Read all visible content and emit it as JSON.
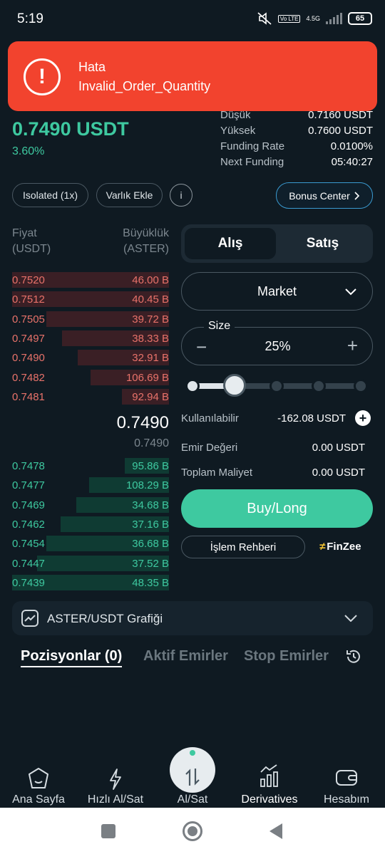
{
  "status_bar": {
    "time": "5:19",
    "lte_label": "Vo LTE",
    "network": "4.5G",
    "battery": "65"
  },
  "toast": {
    "title": "Hata",
    "message": "Invalid_Order_Quantity",
    "icon": "alert-icon",
    "color": "#f2432e"
  },
  "ticker": {
    "price": "0.7490 USDT",
    "change": "3.60%",
    "stats": [
      {
        "label": "Düşük",
        "value": "0.7160 USDT"
      },
      {
        "label": "Yüksek",
        "value": "0.7600 USDT"
      },
      {
        "label": "Funding Rate",
        "value": "0.0100%"
      },
      {
        "label": "Next Funding",
        "value": "05:40:27"
      }
    ]
  },
  "controls": {
    "isolated": "Isolated (1x)",
    "add_asset": "Varlık Ekle",
    "info": "i",
    "bonus": "Bonus Center"
  },
  "orderbook": {
    "header_price": "Fiyat",
    "header_price_unit": "(USDT)",
    "header_size": "Büyüklük",
    "header_size_unit": "(ASTER)",
    "asks": [
      {
        "price": "0.7520",
        "size": "46.00 B",
        "depth": 1.0
      },
      {
        "price": "0.7512",
        "size": "40.45 B",
        "depth": 1.0
      },
      {
        "price": "0.7505",
        "size": "39.72 B",
        "depth": 0.78
      },
      {
        "price": "0.7497",
        "size": "38.33 B",
        "depth": 0.68
      },
      {
        "price": "0.7490",
        "size": "32.91 B",
        "depth": 0.58
      },
      {
        "price": "0.7482",
        "size": "106.69 B",
        "depth": 0.5
      },
      {
        "price": "0.7481",
        "size": "92.94 B",
        "depth": 0.3
      }
    ],
    "mid_price": "0.7490",
    "mark_price": "0.7490",
    "bids": [
      {
        "price": "0.7478",
        "size": "95.86 B",
        "depth": 0.28
      },
      {
        "price": "0.7477",
        "size": "108.29 B",
        "depth": 0.51
      },
      {
        "price": "0.7469",
        "size": "34.68 B",
        "depth": 0.59
      },
      {
        "price": "0.7462",
        "size": "37.16 B",
        "depth": 0.69
      },
      {
        "price": "0.7454",
        "size": "36.68 B",
        "depth": 0.78
      },
      {
        "price": "0.7447",
        "size": "37.52 B",
        "depth": 0.84
      },
      {
        "price": "0.7439",
        "size": "48.35 B",
        "depth": 1.0
      }
    ]
  },
  "trade": {
    "buy_tab": "Alış",
    "sell_tab": "Satış",
    "order_type": "Market",
    "size_label": "Size",
    "size_value": "25%",
    "size_fraction": 0.25,
    "available_label": "Kullanılabilir",
    "available_value": "-162.08 USDT",
    "order_value_label": "Emir Değeri",
    "order_value": "0.00 USDT",
    "total_cost_label": "Toplam Maliyet",
    "total_cost": "0.00 USDT",
    "buy_button": "Buy/Long",
    "guide_button": "İşlem Rehberi",
    "brand": "FinZee"
  },
  "chart_toggle": {
    "label": "ASTER/USDT Grafiği"
  },
  "tabs": [
    "Pozisyonlar (0)",
    "Aktif Emirler",
    "Stop Emirler"
  ],
  "nav": [
    {
      "label": "Ana Sayfa",
      "icon": "home-icon"
    },
    {
      "label": "Hızlı Al/Sat",
      "icon": "lightning-icon"
    },
    {
      "label": "Al/Sat",
      "icon": "swap-icon"
    },
    {
      "label": "Derivatives",
      "icon": "derivatives-icon"
    },
    {
      "label": "Hesabım",
      "icon": "wallet-icon"
    }
  ],
  "colors": {
    "background": "#0f1a22",
    "green": "#3ec9a0",
    "red": "#e8726a",
    "toast": "#f2432e"
  }
}
